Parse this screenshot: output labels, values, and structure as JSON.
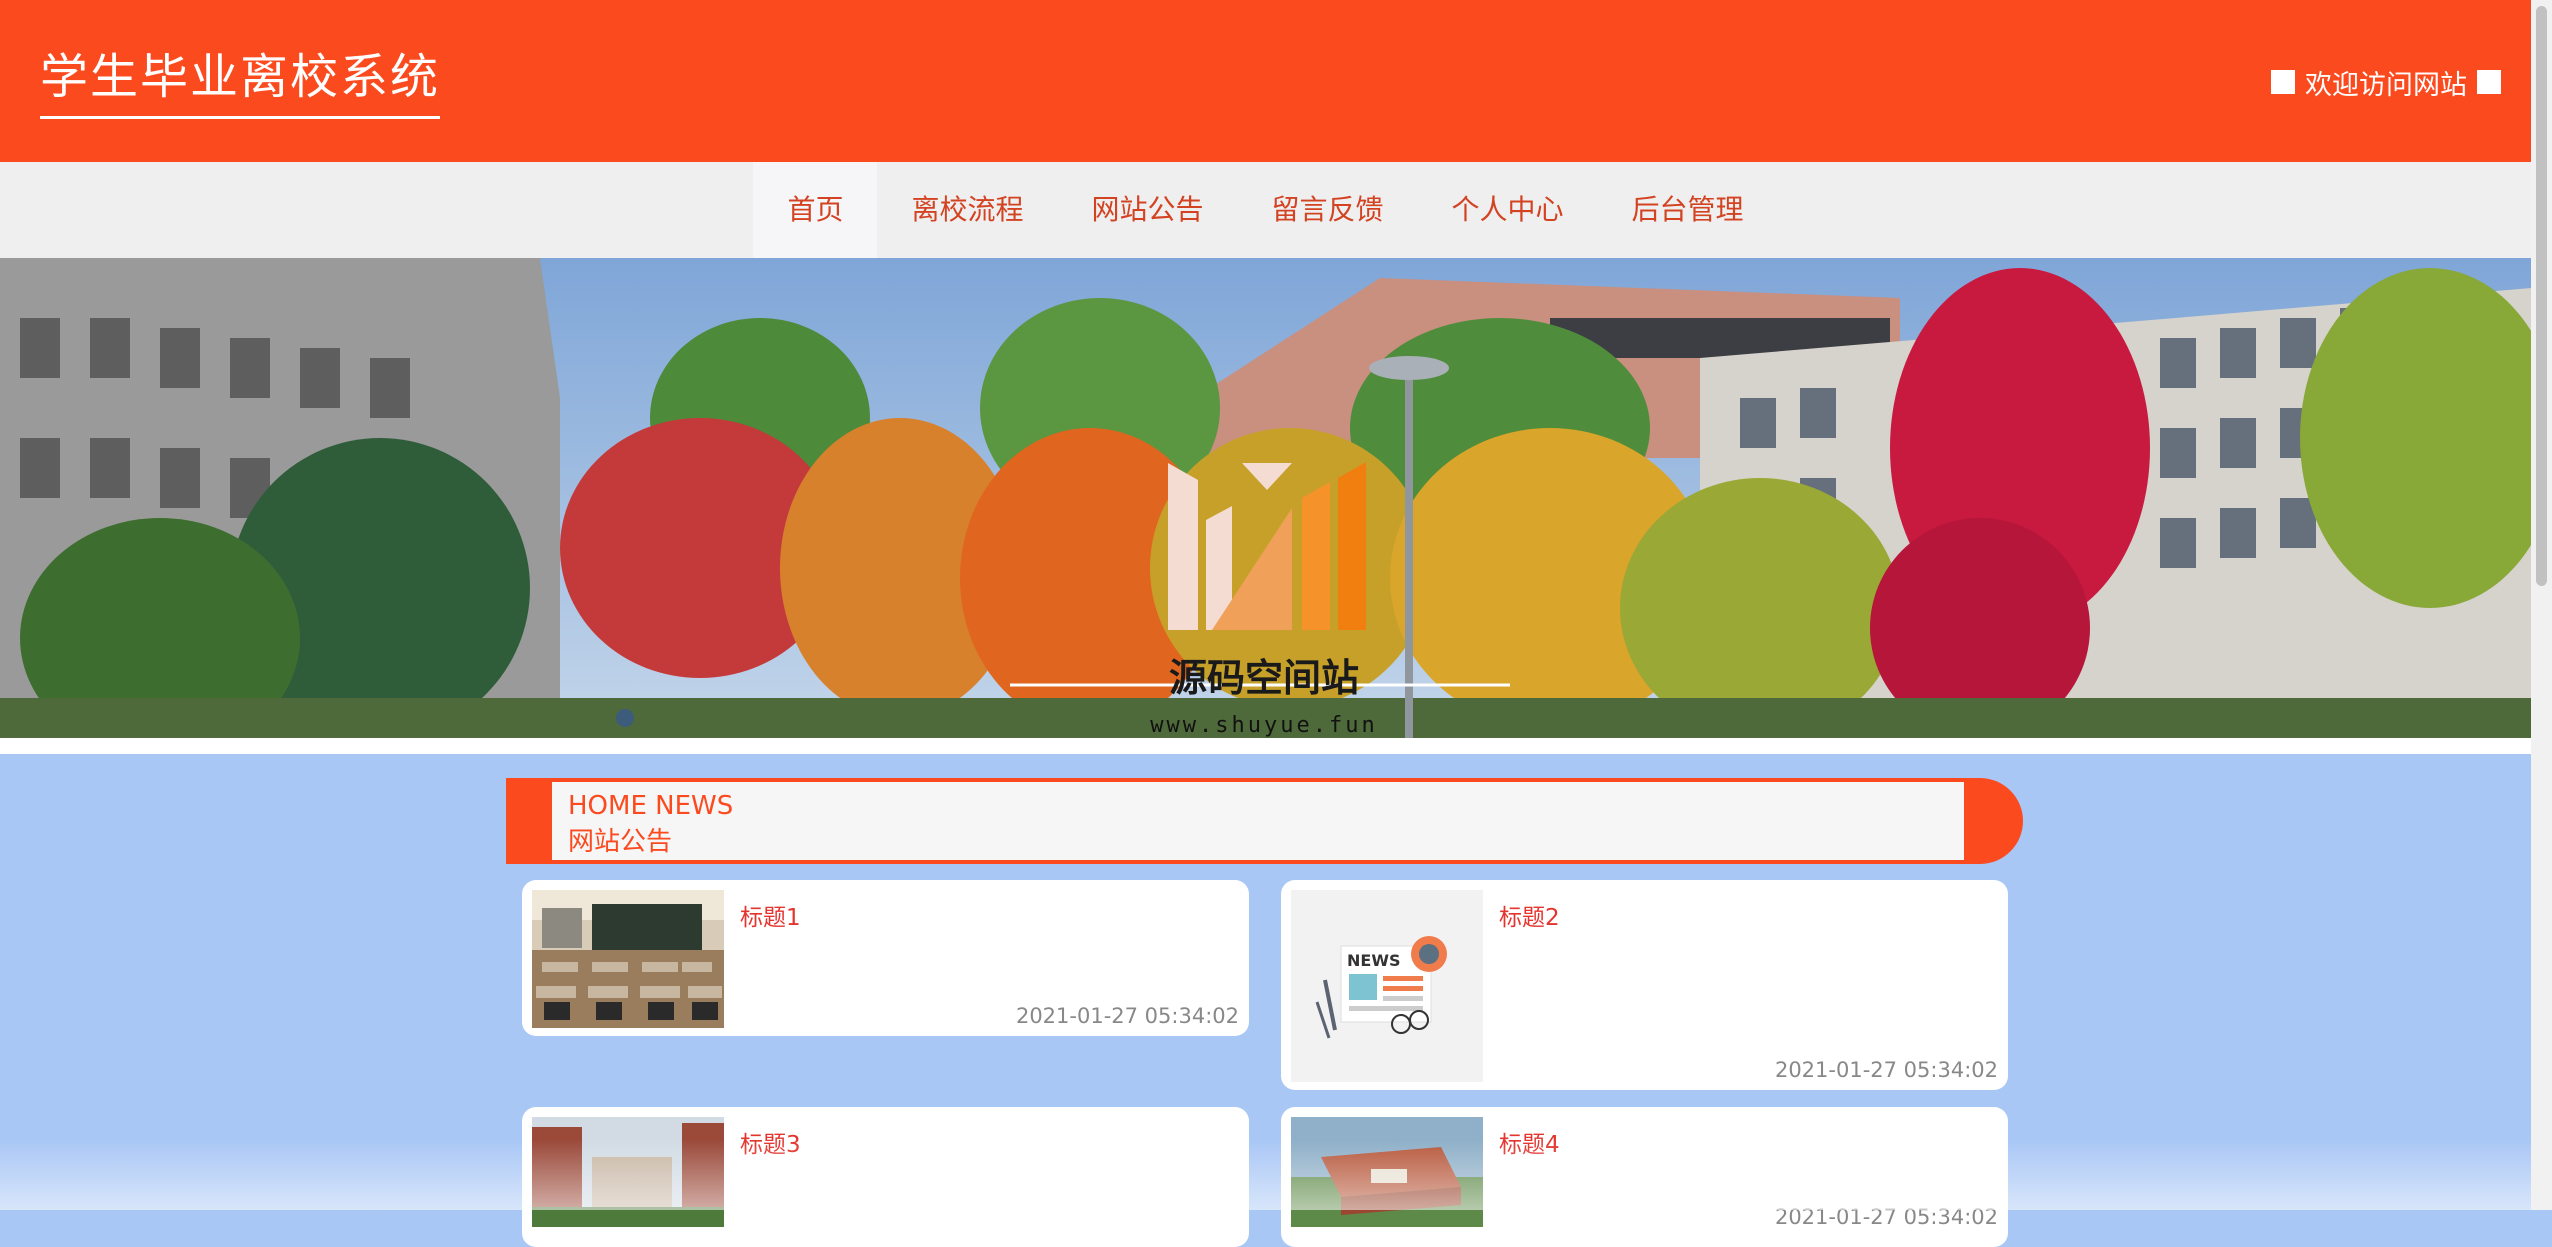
{
  "header": {
    "title": "学生毕业离校系统",
    "welcome": "欢迎访问网站"
  },
  "nav": {
    "items": [
      "首页",
      "离校流程",
      "网站公告",
      "留言反馈",
      "个人中心",
      "后台管理"
    ],
    "active_index": 0
  },
  "banner": {
    "watermark_name": "源码空间站",
    "watermark_url": "www.shuyue.fun"
  },
  "news": {
    "title_en": "HOME NEWS",
    "title_cn": "网站公告",
    "items": [
      {
        "title": "标题1",
        "time": "2021-01-27 05:34:02"
      },
      {
        "title": "标题2",
        "time": "2021-01-27 05:34:02"
      },
      {
        "title": "标题3",
        "time": ""
      },
      {
        "title": "标题4",
        "time": "2021-01-27 05:34:02"
      }
    ]
  },
  "colors": {
    "brand": "#fc4a1f",
    "nav_bg": "#efefef",
    "content_bg": "#a9c7f5",
    "news_title": "#e4342e"
  }
}
